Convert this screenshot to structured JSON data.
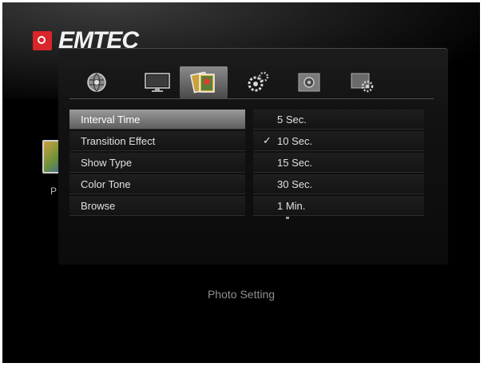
{
  "brand": {
    "name": "EMTEC"
  },
  "tabs": [
    {
      "icon": "globe-settings-icon",
      "active": false
    },
    {
      "icon": "monitor-icon",
      "active": false
    },
    {
      "icon": "photo-icon",
      "active": true
    },
    {
      "icon": "system-gears-icon",
      "active": false
    },
    {
      "icon": "audio-settings-icon",
      "active": false
    },
    {
      "icon": "video-settings-icon",
      "active": false
    }
  ],
  "menu": {
    "items": [
      {
        "label": "Interval Time",
        "highlighted": true
      },
      {
        "label": "Transition Effect"
      },
      {
        "label": "Show Type"
      },
      {
        "label": "Color Tone"
      },
      {
        "label": "Browse"
      }
    ]
  },
  "options": {
    "items": [
      {
        "label": "5 Sec.",
        "checked": false
      },
      {
        "label": "10 Sec.",
        "checked": true
      },
      {
        "label": "15 Sec.",
        "checked": false
      },
      {
        "label": "30 Sec.",
        "checked": false
      },
      {
        "label": "1 Min.",
        "checked": false
      }
    ],
    "check_glyph": "✓"
  },
  "background": {
    "partial_label": "P"
  },
  "caption": "Photo Setting"
}
